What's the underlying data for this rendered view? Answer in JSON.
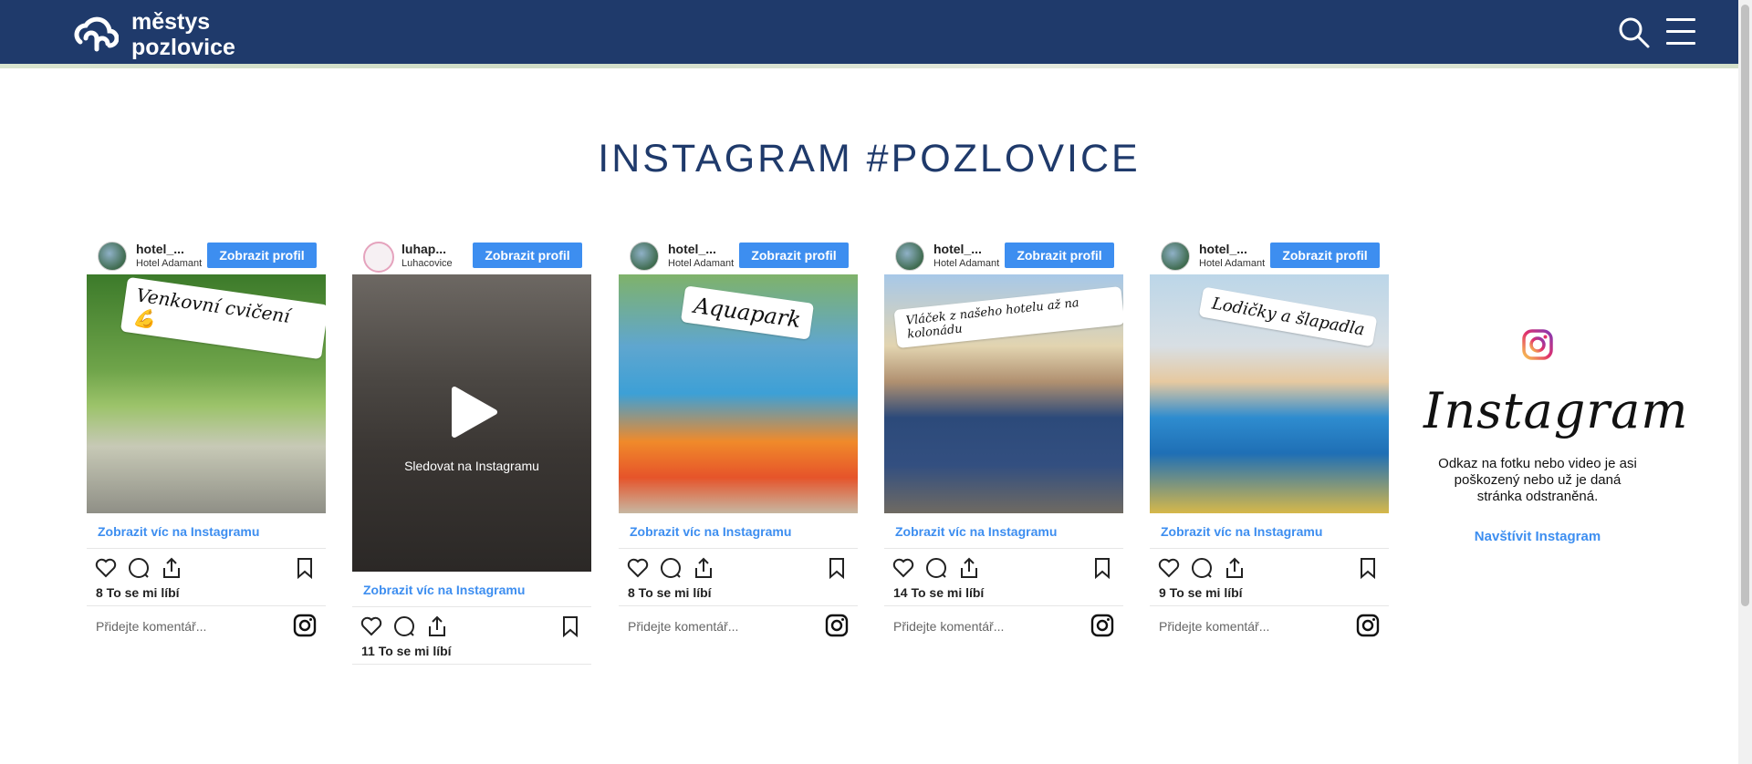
{
  "header": {
    "logo_line1": "městys",
    "logo_line2": "pozlovice",
    "search_icon": "search-icon",
    "menu_icon": "hamburger-menu-icon"
  },
  "section": {
    "title": "INSTAGRAM #POZLOVICE"
  },
  "cards": [
    {
      "username": "hotel_...",
      "fullname": "Hotel Adamant",
      "profile_button": "Zobrazit profil",
      "sticker": "Venkovní cvičení 💪",
      "view_link": "Zobrazit víc na Instagramu",
      "likes": "8 To se mi líbí",
      "comment_placeholder": "Přidejte komentář..."
    },
    {
      "username": "luhap...",
      "fullname": "Luhacovice",
      "profile_button": "Zobrazit profil",
      "watch_text": "Sledovat na Instagramu",
      "view_link": "Zobrazit víc na Instagramu",
      "likes": "11 To se mi líbí"
    },
    {
      "username": "hotel_...",
      "fullname": "Hotel Adamant",
      "profile_button": "Zobrazit profil",
      "sticker": "Aquapark",
      "view_link": "Zobrazit víc na Instagramu",
      "likes": "8 To se mi líbí",
      "comment_placeholder": "Přidejte komentář..."
    },
    {
      "username": "hotel_...",
      "fullname": "Hotel Adamant",
      "profile_button": "Zobrazit profil",
      "sticker": "Vláček z našeho hotelu až na kolonádu",
      "view_link": "Zobrazit víc na Instagramu",
      "likes": "14 To se mi líbí",
      "comment_placeholder": "Přidejte komentář..."
    },
    {
      "username": "hotel_...",
      "fullname": "Hotel Adamant",
      "profile_button": "Zobrazit profil",
      "sticker": "Lodičky a šlapadla",
      "view_link": "Zobrazit víc na Instagramu",
      "likes": "9 To se mi líbí",
      "comment_placeholder": "Přidejte komentář..."
    }
  ],
  "instagram_panel": {
    "wordmark": "Instagram",
    "message": "Odkaz na fotku nebo video je asi poškozený nebo už je daná stránka odstraněná.",
    "visit_link": "Navštívit Instagram"
  },
  "colors": {
    "header_bg": "#1f3a6b",
    "accent": "#3d8ef0",
    "title": "#1f3a6b"
  }
}
